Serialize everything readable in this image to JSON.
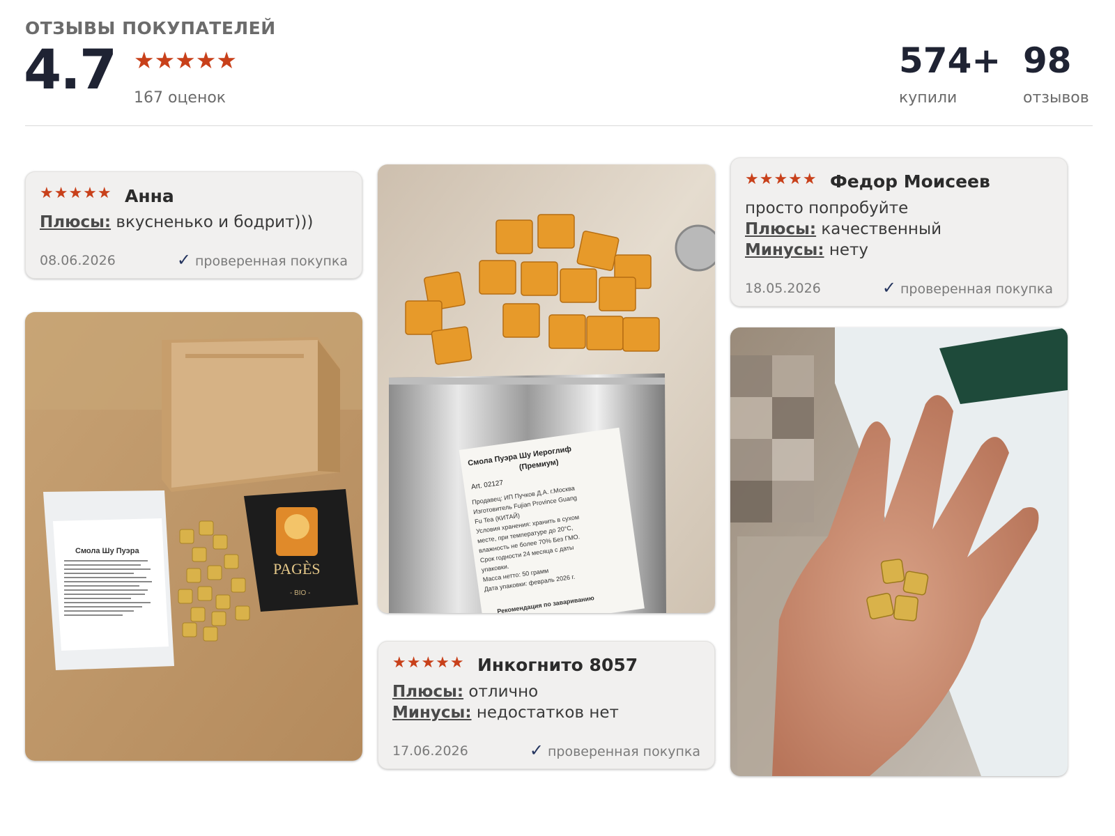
{
  "header": {
    "title": "ОТЗЫВЫ ПОКУПАТЕЛЕЙ",
    "rating": "4.7",
    "stars": "★★★★★",
    "ratings_count": "167 оценок",
    "bought_value": "574+",
    "bought_label": "купили",
    "reviews_value": "98",
    "reviews_label": "отзывов"
  },
  "reviews": [
    {
      "stars": "★★★★★",
      "author": "Анна",
      "pros_label": "Плюсы:",
      "pros": " вкусненько и бодрит)))",
      "date": "08.06.2026",
      "verified": "проверенная покупка"
    },
    {
      "stars": "★★★★★",
      "author": "Федор Моисеев",
      "comment": "просто попробуйте",
      "pros_label": "Плюсы:",
      "pros": " качественный",
      "cons_label": "Минусы:",
      "cons": " нету",
      "date": "18.05.2026",
      "verified": "проверенная покупка"
    },
    {
      "stars": "★★★★★",
      "author": "Инкогнито 8057",
      "pros_label": "Плюсы:",
      "pros": " отлично",
      "cons_label": "Минусы:",
      "cons": " недостатков нет",
      "date": "17.06.2026",
      "verified": "проверенная покупка"
    }
  ],
  "photos": {
    "box_photo": {
      "pouch_title": "Смола Шу Пуэра",
      "sachet_brand": "PAGÈS",
      "sachet_bio": "- BIO -"
    },
    "bag_photo": {
      "label_title": "Смола Пуэра Шу Иероглиф",
      "label_subtitle": "(Премиум)",
      "label_art": "Art. 02127",
      "label_lines": [
        "Продавец: ИП Пучков Д.А. г.Москва",
        "Изготовитель Fujian Province Guang",
        "Fu Tea (КИТАЙ)",
        "Условия хранения: хранить в сухом",
        "месте, при температуре до 20°С,",
        "влажность не более 70% Без ГМО.",
        "Срок годности 24 месяца с даты",
        "упаковки.",
        "Масса нетто: 50 грамм",
        "Дата упаковки: февраль 2026 г."
      ],
      "label_footer": "Рекомендация по завариванию"
    },
    "hand_photo": {}
  },
  "colors": {
    "star": "#c8401a",
    "check": "#24345e",
    "card_bg": "#f1f0ef"
  }
}
